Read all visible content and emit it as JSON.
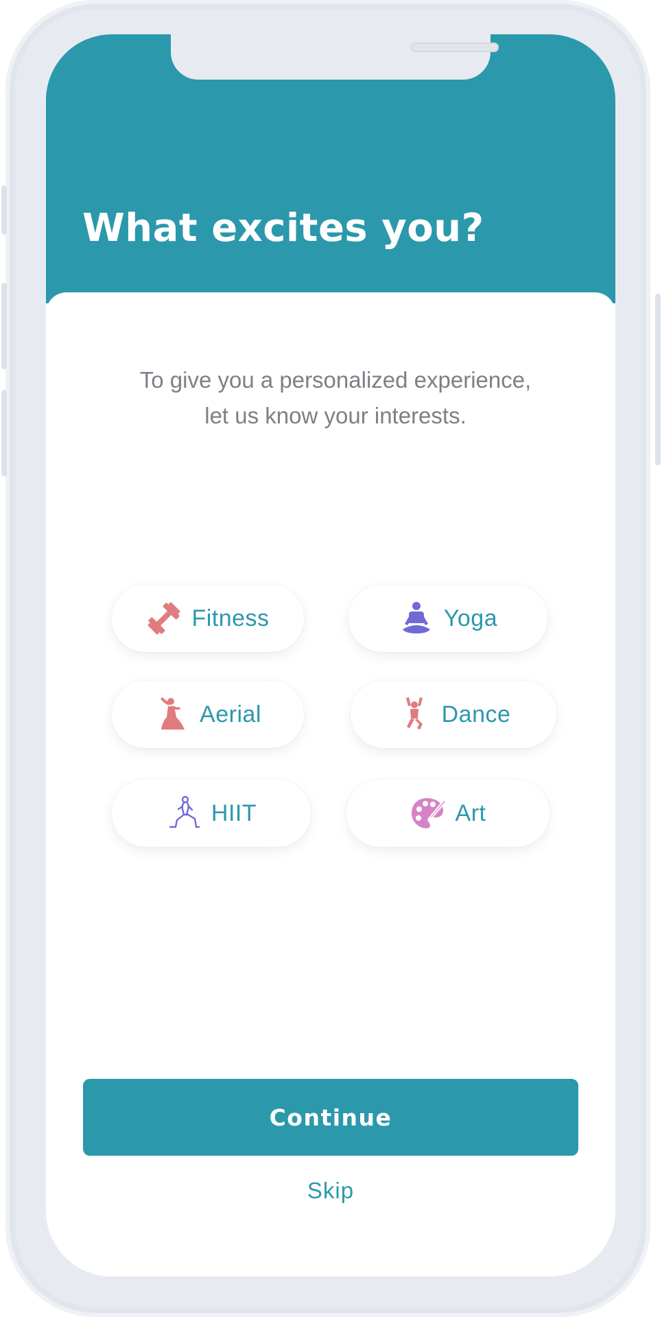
{
  "header": {
    "title": "What excites you?"
  },
  "intro": {
    "line1": "To give you a personalized experience,",
    "line2": "let us know your interests."
  },
  "interests": [
    {
      "label": "Fitness",
      "icon": "dumbbell-icon",
      "color": "#e07b80"
    },
    {
      "label": "Yoga",
      "icon": "meditation-icon",
      "color": "#6f6ad6"
    },
    {
      "label": "Aerial",
      "icon": "aerial-dancer-icon",
      "color": "#e07b80"
    },
    {
      "label": "Dance",
      "icon": "dancer-icon",
      "color": "#e07b80"
    },
    {
      "label": "HIIT",
      "icon": "lunge-exercise-icon",
      "color": "#6f6ad6"
    },
    {
      "label": "Art",
      "icon": "paint-palette-icon",
      "color": "#d683c6"
    }
  ],
  "actions": {
    "continue_label": "Continue",
    "skip_label": "Skip"
  },
  "colors": {
    "primary": "#2b98ab",
    "text_muted": "#7c7f85",
    "frame": "#e7ebf1"
  }
}
